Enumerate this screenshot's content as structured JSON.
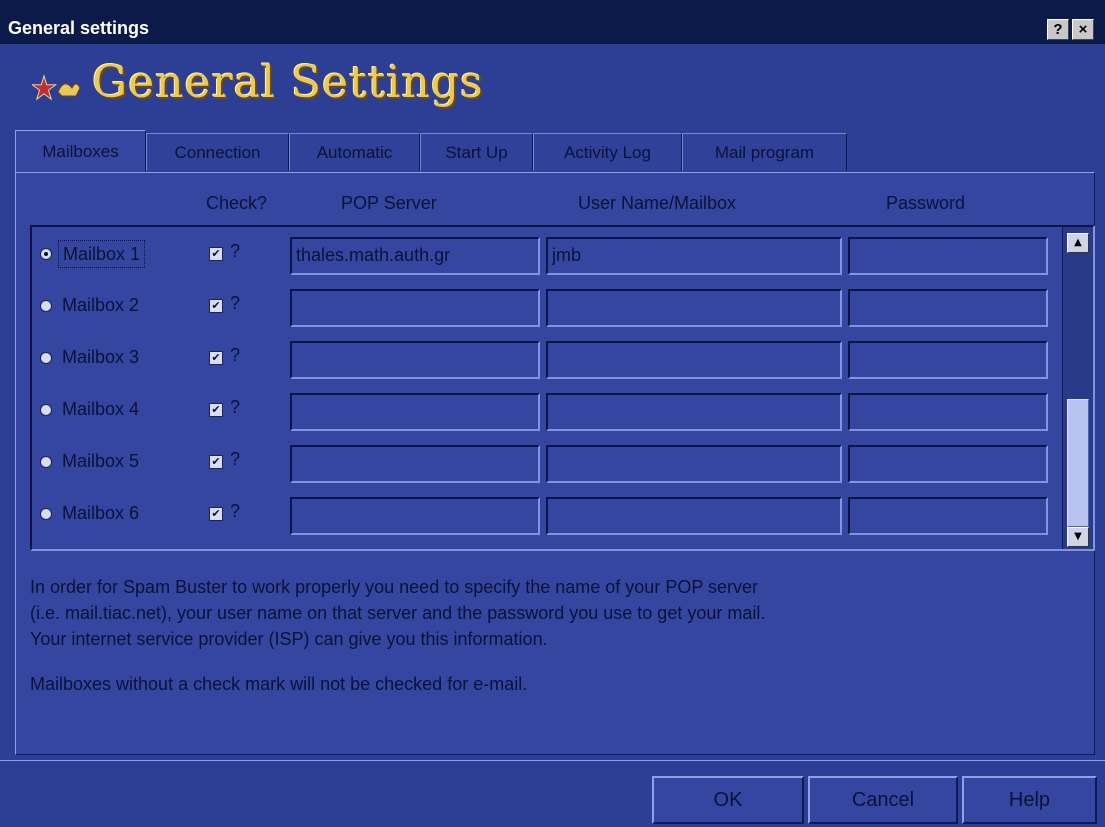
{
  "window": {
    "title": "General settings",
    "help_button": "?",
    "close_button": "×",
    "banner_title": "General Settings"
  },
  "tabs": [
    {
      "label": "Mailboxes",
      "active": true
    },
    {
      "label": "Connection",
      "active": false
    },
    {
      "label": "Automatic",
      "active": false
    },
    {
      "label": "Start Up",
      "active": false
    },
    {
      "label": "Activity Log",
      "active": false
    },
    {
      "label": "Mail program",
      "active": false
    }
  ],
  "columns": {
    "check": "Check?",
    "pop_server": "POP Server",
    "user_name": "User Name/Mailbox",
    "password": "Password"
  },
  "mailboxes": [
    {
      "label": "Mailbox 1",
      "selected": true,
      "checked": true,
      "check_hint": "?",
      "pop_server": "thales.math.auth.gr",
      "user_name": "jmb",
      "password": ""
    },
    {
      "label": "Mailbox 2",
      "selected": false,
      "checked": true,
      "check_hint": "?",
      "pop_server": "",
      "user_name": "",
      "password": ""
    },
    {
      "label": "Mailbox 3",
      "selected": false,
      "checked": true,
      "check_hint": "?",
      "pop_server": "",
      "user_name": "",
      "password": ""
    },
    {
      "label": "Mailbox 4",
      "selected": false,
      "checked": true,
      "check_hint": "?",
      "pop_server": "",
      "user_name": "",
      "password": ""
    },
    {
      "label": "Mailbox 5",
      "selected": false,
      "checked": true,
      "check_hint": "?",
      "pop_server": "",
      "user_name": "",
      "password": ""
    },
    {
      "label": "Mailbox 6",
      "selected": false,
      "checked": true,
      "check_hint": "?",
      "pop_server": "",
      "user_name": "",
      "password": ""
    }
  ],
  "help_text": {
    "line1": "In order for Spam Buster to work properly you need to specify the name of your POP server",
    "line2": "(i.e. mail.tiac.net), your user name on that server and the password you use to get your mail.",
    "line3": "Your internet service provider (ISP) can give you this information.",
    "line4": "Mailboxes without a check mark will not be checked for e-mail."
  },
  "buttons": {
    "ok": "OK",
    "cancel": "Cancel",
    "help": "Help"
  },
  "colors": {
    "background": "#2d3f94",
    "panel": "#3446a0",
    "titlebar": "#0c1a4a",
    "banner_gold": "#e9c95a"
  }
}
